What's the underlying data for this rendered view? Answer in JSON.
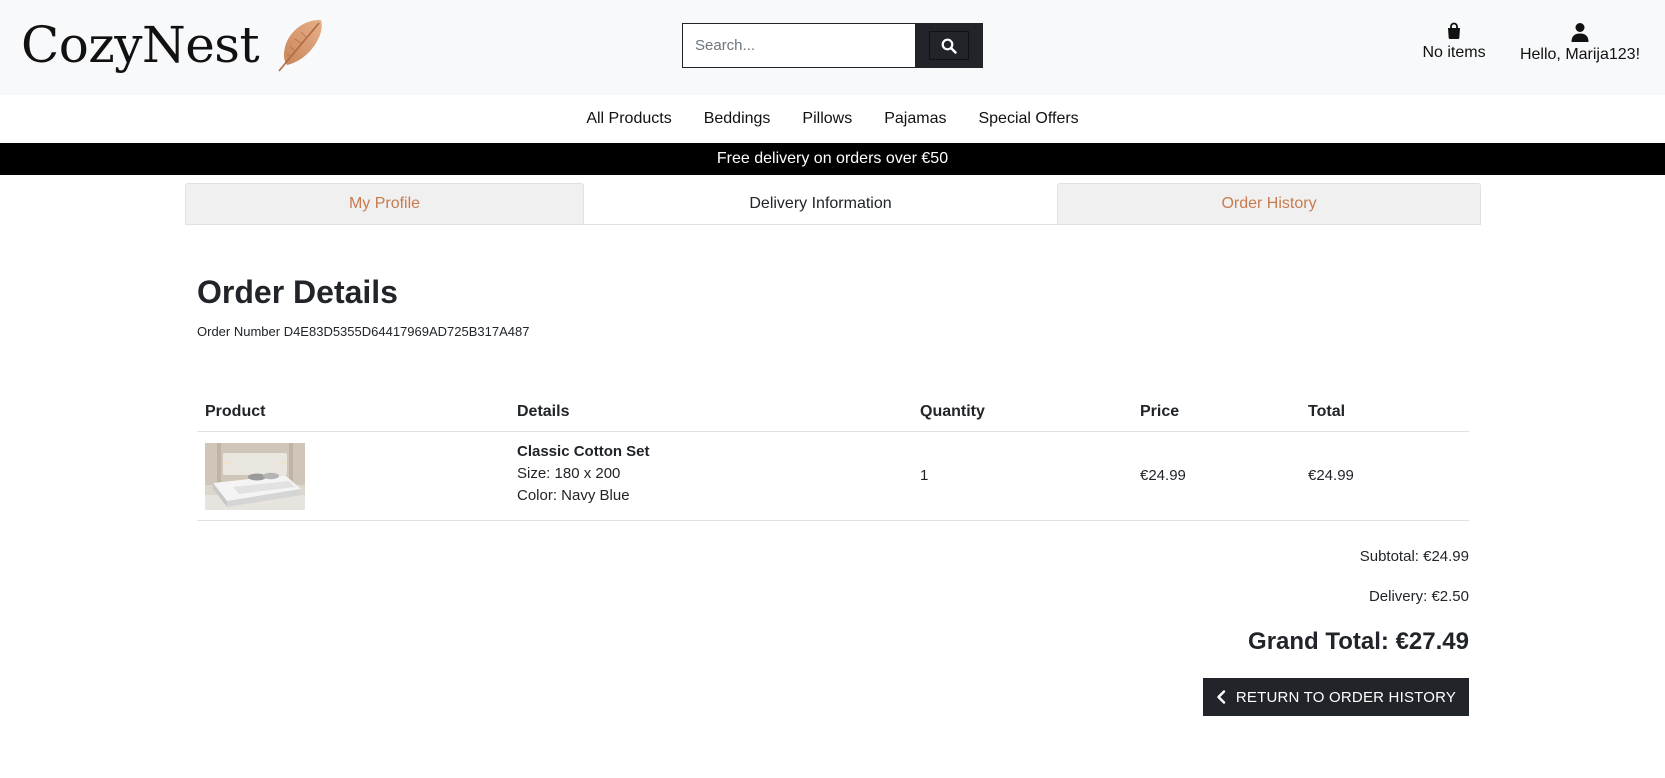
{
  "header": {
    "brand": "CozyNest",
    "search_placeholder": "Search...",
    "bag_label": "No items",
    "user_label": "Hello, Marija123!"
  },
  "nav": {
    "items": [
      "All Products",
      "Beddings",
      "Pillows",
      "Pajamas",
      "Special Offers"
    ]
  },
  "banner": {
    "text": "Free delivery on orders over €50"
  },
  "tabs": {
    "profile": "My Profile",
    "delivery": "Delivery Information",
    "history": "Order History"
  },
  "order": {
    "title": "Order Details",
    "number_line": "Order Number D4E83D5355D64417969AD725B317A487",
    "columns": [
      "Product",
      "Details",
      "Quantity",
      "Price",
      "Total"
    ],
    "items": [
      {
        "name": "Classic Cotton Set",
        "size": "Size: 180 x 200",
        "color": "Color: Navy Blue",
        "quantity": "1",
        "price": "€24.99",
        "total": "€24.99"
      }
    ],
    "subtotal": "Subtotal: €24.99",
    "delivery": "Delivery: €2.50",
    "grand_total": "Grand Total: €27.49",
    "return_label": "RETURN TO ORDER HISTORY"
  },
  "colors": {
    "accent": "#c97b4f",
    "dark": "#212529",
    "header_bg": "#f8f9fa",
    "banner_bg": "#000000"
  },
  "icons": {
    "brand": "feather-icon",
    "search": "search-icon",
    "bag": "shopping-bag-icon",
    "user": "user-icon",
    "return": "chevron-left-icon"
  }
}
